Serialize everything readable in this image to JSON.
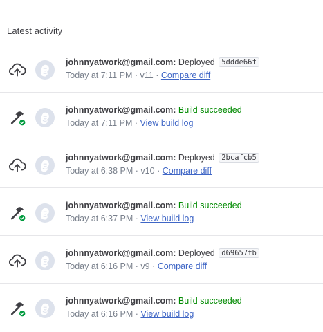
{
  "title": "Latest activity",
  "activity": [
    {
      "kind": "deploy",
      "icon": "deploy-arrow-icon",
      "user": "johnnyatwork@gmail.com:",
      "action": "Deployed",
      "commit": "5ddde66f",
      "time": "Today at 7:11 PM",
      "version": "v11",
      "link": "Compare diff"
    },
    {
      "kind": "build",
      "icon": "build-hammer-success-icon",
      "user": "johnnyatwork@gmail.com:",
      "action": "Build succeeded",
      "time": "Today at 7:11 PM",
      "link": "View build log"
    },
    {
      "kind": "deploy",
      "icon": "deploy-arrow-icon",
      "user": "johnnyatwork@gmail.com:",
      "action": "Deployed",
      "commit": "2bcafcb5",
      "time": "Today at 6:38 PM",
      "version": "v10",
      "link": "Compare diff"
    },
    {
      "kind": "build",
      "icon": "build-hammer-success-icon",
      "user": "johnnyatwork@gmail.com:",
      "action": "Build succeeded",
      "time": "Today at 6:37 PM",
      "link": "View build log"
    },
    {
      "kind": "deploy",
      "icon": "deploy-arrow-icon",
      "user": "johnnyatwork@gmail.com:",
      "action": "Deployed",
      "commit": "d69657fb",
      "time": "Today at 6:16 PM",
      "version": "v9",
      "link": "Compare diff"
    },
    {
      "kind": "build",
      "icon": "build-hammer-success-icon",
      "user": "johnnyatwork@gmail.com:",
      "action": "Build succeeded",
      "time": "Today at 6:16 PM",
      "link": "View build log"
    }
  ],
  "colors": {
    "success": "#008a00",
    "link": "#3f66c6",
    "muted": "#79808c",
    "text": "#3f3f44",
    "avatar_bg": "#dde2ec"
  }
}
